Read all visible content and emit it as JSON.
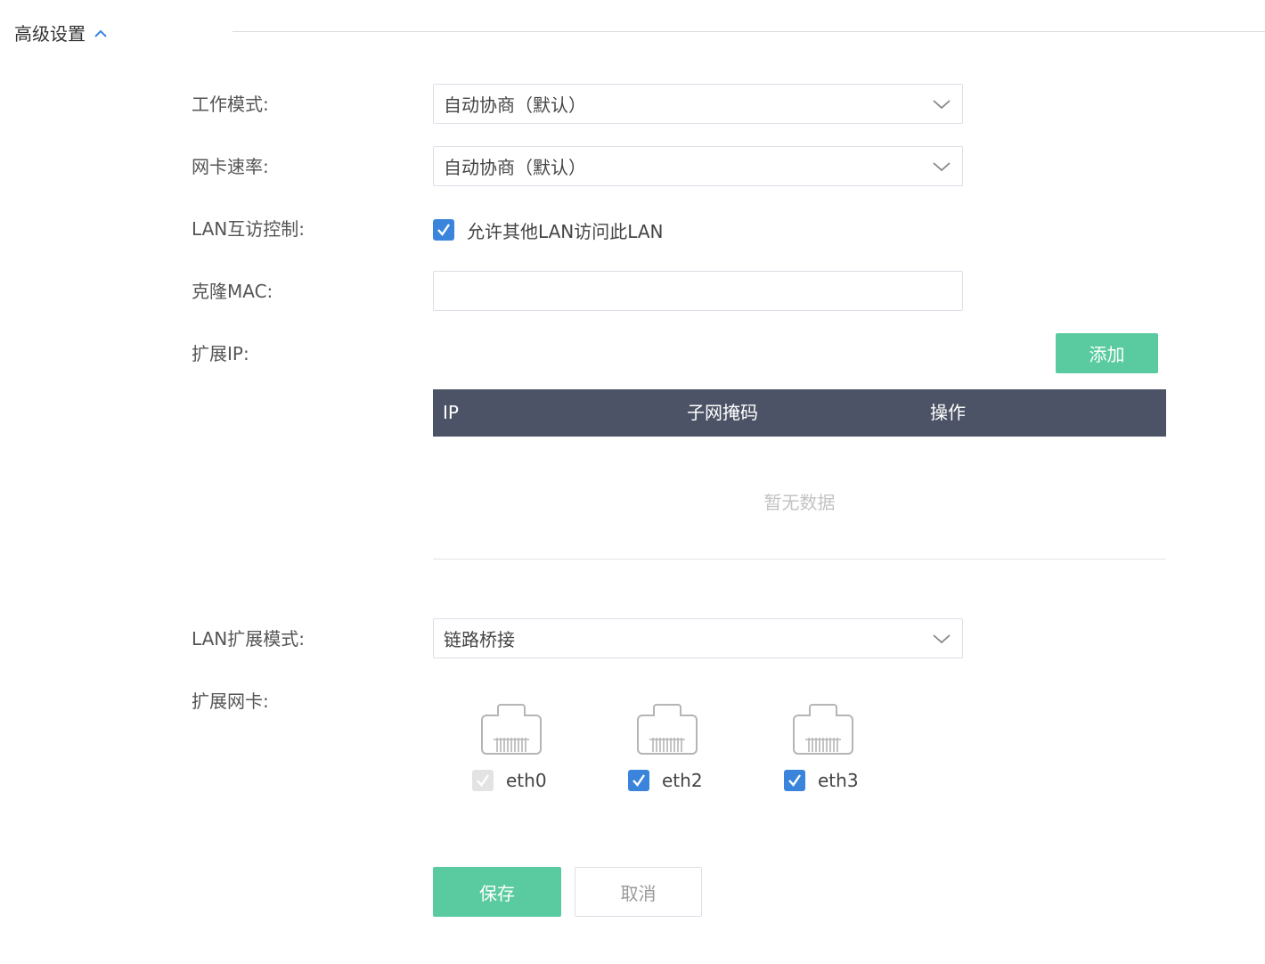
{
  "section": {
    "title": "高级设置"
  },
  "work_mode": {
    "label": "工作模式:",
    "value": "自动协商（默认）"
  },
  "nic_rate": {
    "label": "网卡速率:",
    "value": "自动协商（默认）"
  },
  "lan_access": {
    "label": "LAN互访控制:",
    "checkbox_label": "允许其他LAN访问此LAN",
    "checked": true
  },
  "clone_mac": {
    "label": "克隆MAC:",
    "value": "",
    "placeholder": ""
  },
  "ext_ip": {
    "label": "扩展IP:",
    "add_button": "添加",
    "table": {
      "columns": [
        "IP",
        "子网掩码",
        "操作"
      ],
      "rows": [],
      "empty_text": "暂无数据"
    }
  },
  "lan_ext_mode": {
    "label": "LAN扩展模式:",
    "value": "链路桥接"
  },
  "ext_nic": {
    "label": "扩展网卡:",
    "ports": [
      {
        "name": "eth0",
        "checked": true,
        "disabled": true
      },
      {
        "name": "eth2",
        "checked": true,
        "disabled": false
      },
      {
        "name": "eth3",
        "checked": true,
        "disabled": false
      }
    ]
  },
  "actions": {
    "save": "保存",
    "cancel": "取消"
  },
  "colors": {
    "primary_green": "#5acba0",
    "checkbox_blue": "#3a84dc",
    "table_header": "#4c5366",
    "section_accent": "#3a84dc"
  }
}
